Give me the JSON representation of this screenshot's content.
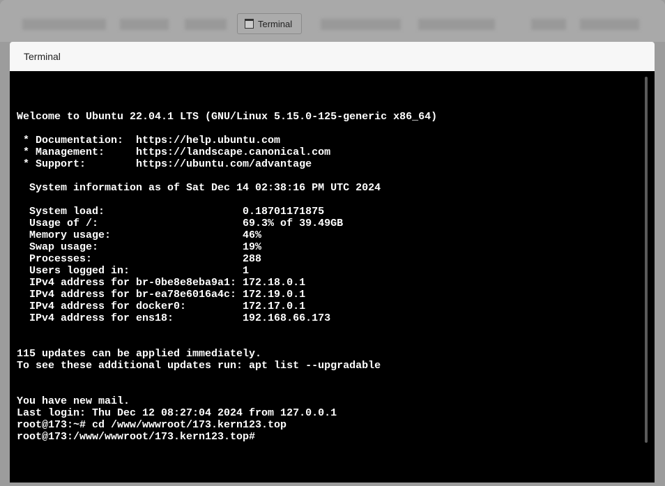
{
  "toolbar": {
    "terminal_button": "Terminal"
  },
  "dialog": {
    "title": "Terminal"
  },
  "terminal": {
    "lines": [
      "Welcome to Ubuntu 22.04.1 LTS (GNU/Linux 5.15.0-125-generic x86_64)",
      "",
      " * Documentation:  https://help.ubuntu.com",
      " * Management:     https://landscape.canonical.com",
      " * Support:        https://ubuntu.com/advantage",
      "",
      "  System information as of Sat Dec 14 02:38:16 PM UTC 2024",
      "",
      "  System load:                      0.18701171875",
      "  Usage of /:                       69.3% of 39.49GB",
      "  Memory usage:                     46%",
      "  Swap usage:                       19%",
      "  Processes:                        288",
      "  Users logged in:                  1",
      "  IPv4 address for br-0be8e8eba9a1: 172.18.0.1",
      "  IPv4 address for br-ea78e6016a4c: 172.19.0.1",
      "  IPv4 address for docker0:         172.17.0.1",
      "  IPv4 address for ens18:           192.168.66.173",
      "",
      "",
      "115 updates can be applied immediately.",
      "To see these additional updates run: apt list --upgradable",
      "",
      "",
      "You have new mail.",
      "Last login: Thu Dec 12 08:27:04 2024 from 127.0.0.1",
      "root@173:~# cd /www/wwwroot/173.kern123.top",
      "root@173:/www/wwwroot/173.kern123.top#"
    ]
  }
}
